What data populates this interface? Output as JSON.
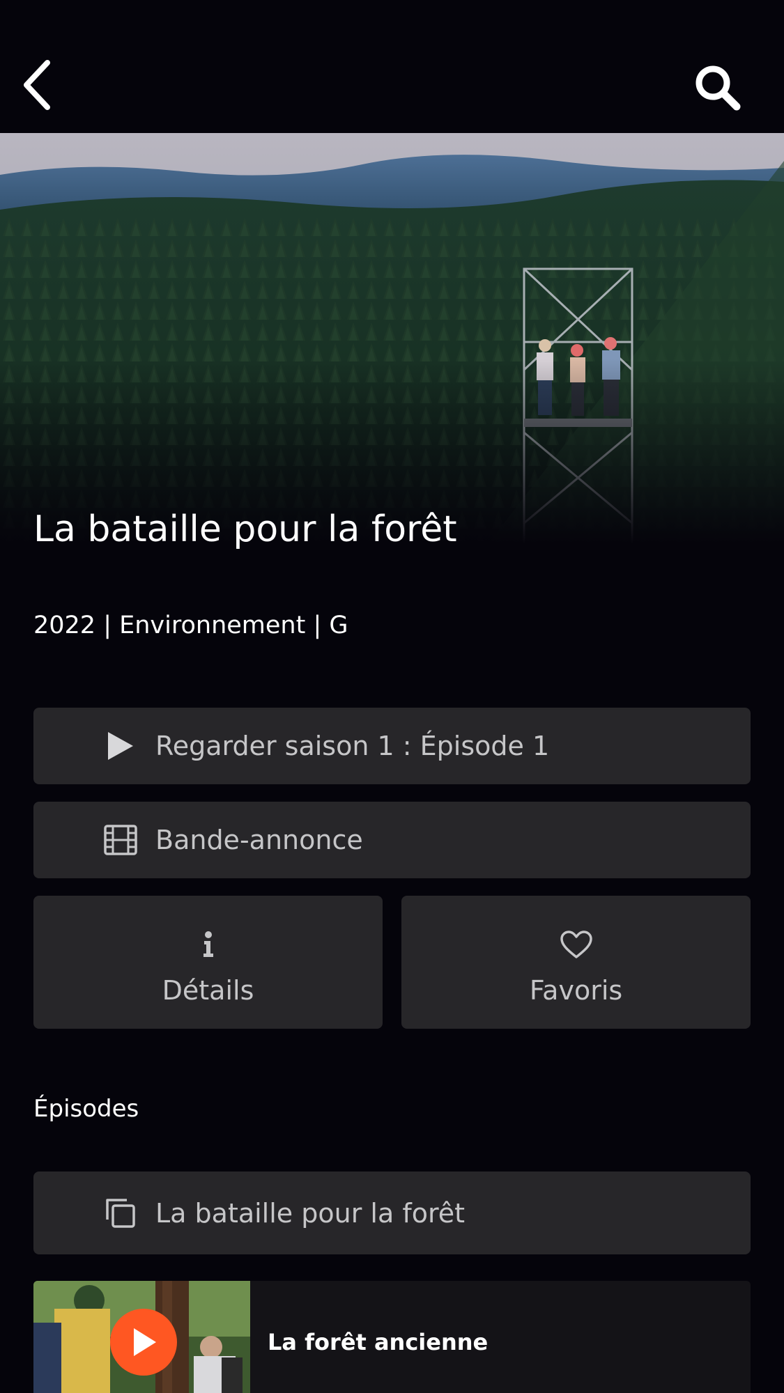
{
  "header": {
    "back_icon": "chevron-left-icon",
    "search_icon": "search-icon"
  },
  "hero": {
    "image": "aerial-forest-observation-tower"
  },
  "show": {
    "title": "La bataille pour la forêt",
    "meta": "2022 | Environnement | G"
  },
  "actions": {
    "play_label": "Regarder saison 1 : Épisode 1",
    "play_icon": "play-icon",
    "trailer_label": "Bande-annonce",
    "trailer_icon": "film-icon",
    "details_label": "Détails",
    "details_icon": "info-icon",
    "favorites_label": "Favoris",
    "favorites_icon": "heart-icon"
  },
  "episodes": {
    "section_title": "Épisodes",
    "season_selector_label": "La bataille pour la forêt",
    "season_selector_icon": "collection-icon",
    "items": [
      {
        "title": "La forêt ancienne",
        "thumbnail": "people-measuring-tree"
      }
    ]
  },
  "colors": {
    "background": "#05040b",
    "button_bg": "#272629",
    "button_text": "#c6c6c8",
    "accent_play": "#ff5722"
  }
}
